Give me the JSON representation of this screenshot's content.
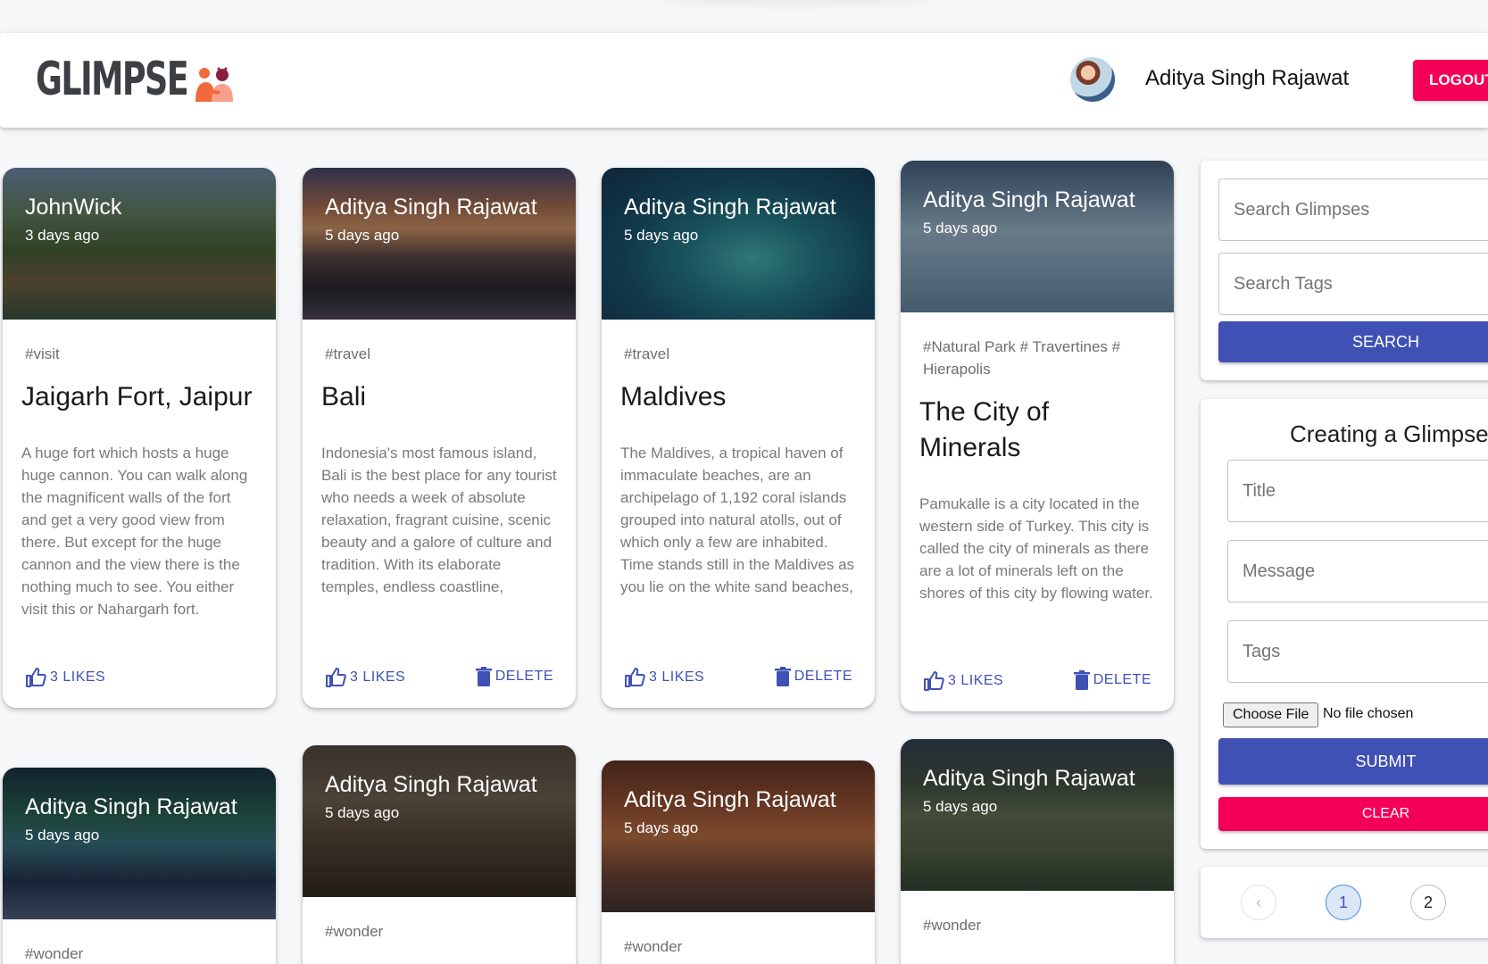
{
  "header": {
    "brand": "GLIMPSE",
    "user_name": "Aditya Singh Rajawat",
    "logout_label": "LOGOUT"
  },
  "posts": [
    {
      "author": "JohnWick",
      "time": "3 days ago",
      "tags": "#visit",
      "title": "Jaigarh Fort, Jaipur",
      "message": "A huge fort which hosts a huge huge cannon. You can walk along the magnificent walls of the fort and get a very good view from there. But except for the huge cannon and the view there is the nothing much to see. You either visit this or Nahargarh fort.",
      "likes": "3 LIKES"
    },
    {
      "author": "Aditya Singh Rajawat",
      "time": "5 days ago",
      "tags": "#travel",
      "title": "Bali",
      "message": "Indonesia's most famous island, Bali is the best place for any tourist who needs a week of absolute relaxation, fragrant cuisine, scenic beauty and a galore of culture and tradition. With its elaborate temples, endless coastline,",
      "likes": "3 LIKES",
      "delete": "DELETE"
    },
    {
      "author": "Aditya Singh Rajawat",
      "time": "5 days ago",
      "tags": "#travel",
      "title": "Maldives",
      "message": "The Maldives, a tropical haven of immaculate beaches, are an archipelago of 1,192 coral islands grouped into natural atolls, out of which only a few are inhabited. Time stands still in the Maldives as you lie on the white sand beaches,",
      "likes": "3 LIKES",
      "delete": "DELETE"
    },
    {
      "author": "Aditya Singh Rajawat",
      "time": "5 days ago",
      "tags": "#Natural Park # Travertines # Hierapolis",
      "title": "The City of Minerals",
      "message": "Pamukalle is a city located in the western side of Turkey. This city is called the city of minerals as there are a lot of minerals left on the shores of this city by flowing water.",
      "likes": "3 LIKES",
      "delete": "DELETE"
    },
    {
      "author": "Aditya Singh Rajawat",
      "time": "5 days ago",
      "tags": "#wonder"
    },
    {
      "author": "Aditya Singh Rajawat",
      "time": "5 days ago",
      "tags": "#wonder"
    },
    {
      "author": "Aditya Singh Rajawat",
      "time": "5 days ago",
      "tags": "#wonder"
    },
    {
      "author": "Aditya Singh Rajawat",
      "time": "5 days ago",
      "tags": "#wonder"
    }
  ],
  "search": {
    "glimpses_placeholder": "Search Glimpses",
    "tags_placeholder": "Search Tags",
    "button": "SEARCH"
  },
  "form": {
    "title": "Creating a Glimpse",
    "title_placeholder": "Title",
    "message_placeholder": "Message",
    "tags_placeholder": "Tags",
    "file_button": "Choose File",
    "file_status": "No file chosen",
    "submit": "SUBMIT",
    "clear": "CLEAR"
  },
  "pagination": {
    "prev": "‹",
    "pages": [
      "1",
      "2"
    ],
    "current": "1"
  },
  "colors": {
    "primary": "#3f51b5",
    "secondary": "#f50057"
  }
}
